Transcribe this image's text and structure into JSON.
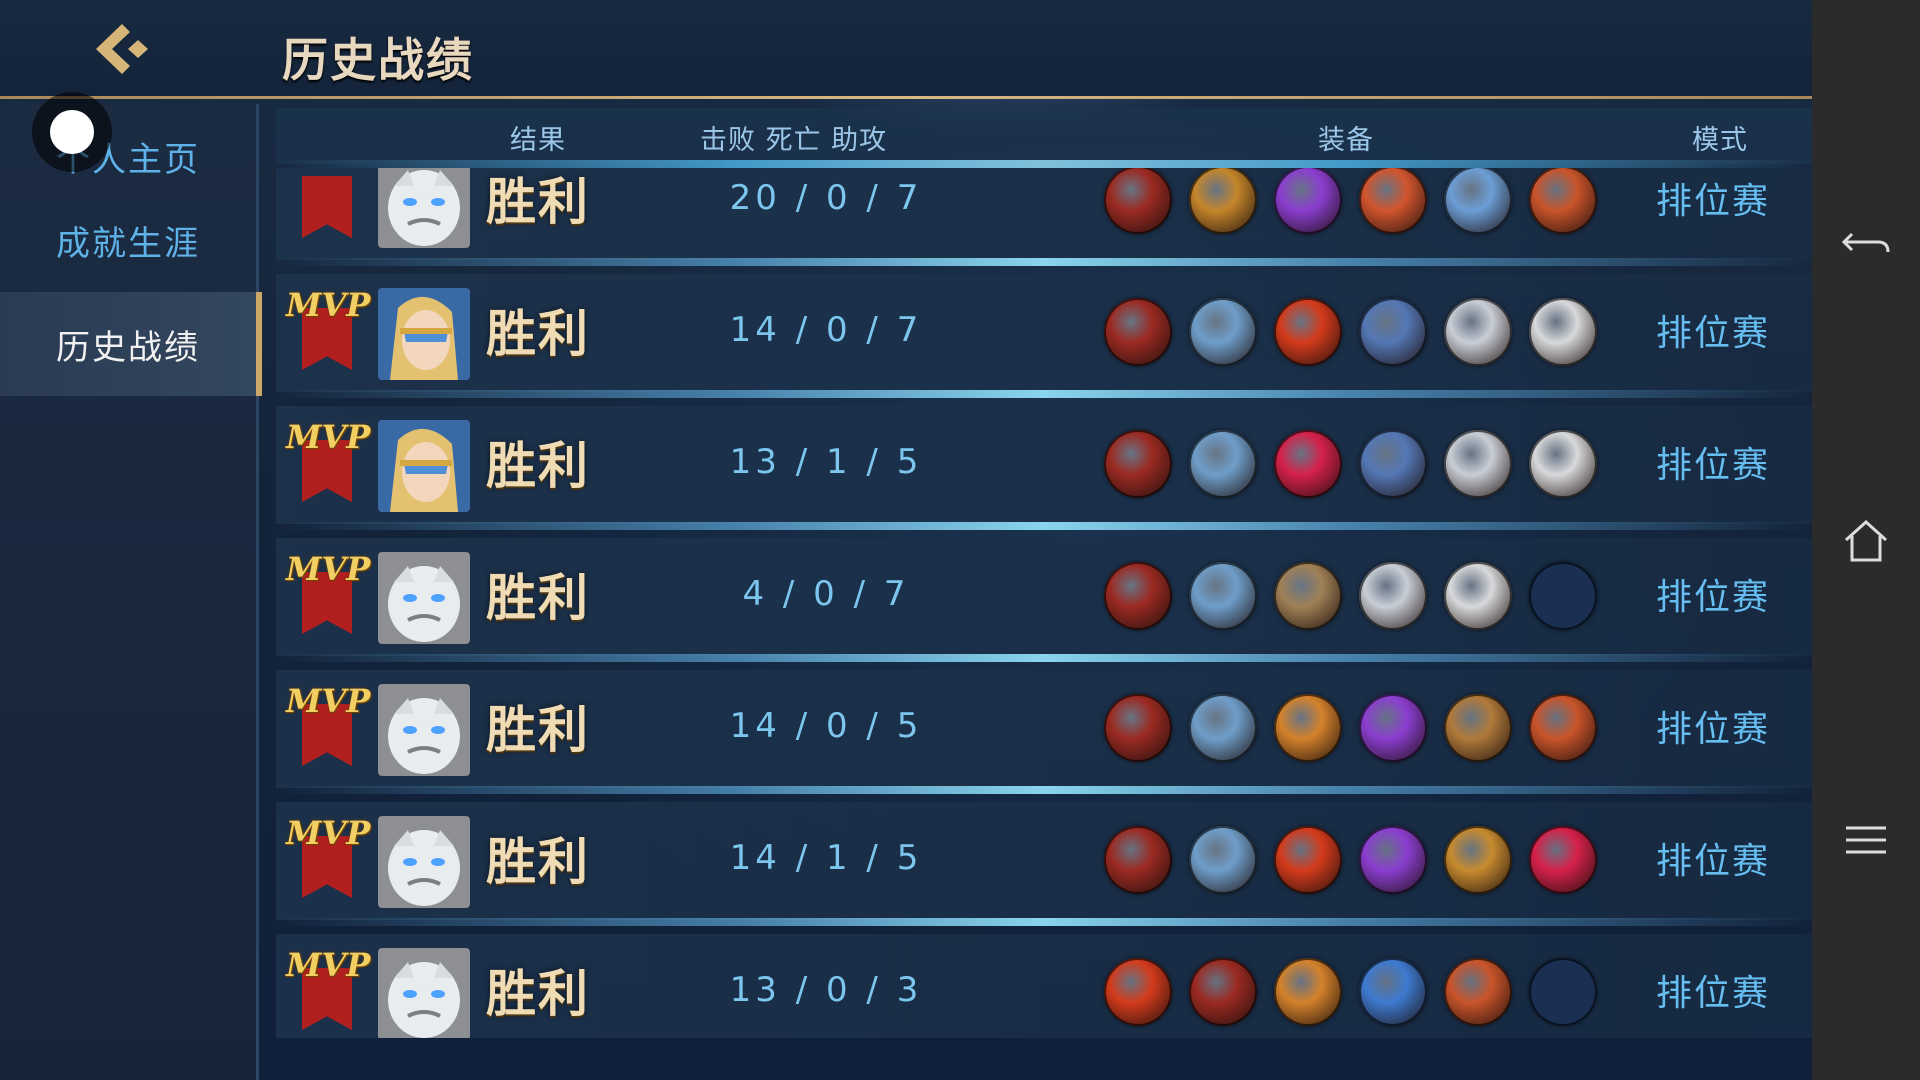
{
  "header": {
    "title": "历史战绩"
  },
  "sidebar": {
    "items": [
      {
        "label": "个人主页"
      },
      {
        "label": "成就生涯"
      },
      {
        "label": "历史战绩"
      }
    ]
  },
  "columns": {
    "result": "结果",
    "kda": "击败 死亡 助攻",
    "equipment": "装备",
    "mode": "模式"
  },
  "matches": [
    {
      "mvp": false,
      "result": "胜利",
      "kda": "20 / 0 / 7",
      "mode": "排位赛",
      "hero_icon": "white-beast-hero-icon",
      "items": [
        "#9b2a22",
        "#c5862b",
        "#8b3ed0",
        "#d2552e",
        "#6c9ed6",
        "#c9542a"
      ]
    },
    {
      "mvp": true,
      "mvp_label": "MVP",
      "result": "胜利",
      "kda": "14 / 0 / 7",
      "mode": "排位赛",
      "hero_icon": "masked-blonde-hero-icon",
      "items": [
        "#9b2a22",
        "#6f9ec9",
        "#d43b1c",
        "#5477b5",
        "#c9ced6",
        "#d8d9db"
      ]
    },
    {
      "mvp": true,
      "mvp_label": "MVP",
      "result": "胜利",
      "kda": "13 / 1 / 5",
      "mode": "排位赛",
      "hero_icon": "masked-blonde-hero-icon",
      "items": [
        "#9b2a22",
        "#6f9ec9",
        "#d6214a",
        "#5477b5",
        "#c9ced6",
        "#d8d9db"
      ]
    },
    {
      "mvp": true,
      "mvp_label": "MVP",
      "result": "胜利",
      "kda": "4 / 0 / 7",
      "mode": "排位赛",
      "hero_icon": "white-beast-hero-icon",
      "items": [
        "#9b2a22",
        "#6f9ec9",
        "#a08156",
        "#c9ced6",
        "#d8d9db",
        "empty"
      ]
    },
    {
      "mvp": true,
      "mvp_label": "MVP",
      "result": "胜利",
      "kda": "14 / 0 / 5",
      "mode": "排位赛",
      "hero_icon": "white-beast-hero-icon",
      "items": [
        "#9b2a22",
        "#6f9ec9",
        "#d4822b",
        "#8b3ed0",
        "#b07a3a",
        "#c9542a"
      ]
    },
    {
      "mvp": true,
      "mvp_label": "MVP",
      "result": "胜利",
      "kda": "14 / 1 / 5",
      "mode": "排位赛",
      "hero_icon": "white-beast-hero-icon",
      "items": [
        "#9b2a22",
        "#6f9ec9",
        "#d43b1c",
        "#8b3ed0",
        "#c78b2f",
        "#d6214a"
      ]
    },
    {
      "mvp": true,
      "mvp_label": "MVP",
      "result": "胜利",
      "kda": "13 / 0 / 3",
      "mode": "排位赛",
      "hero_icon": "white-beast-hero-icon",
      "items": [
        "#d43b1c",
        "#9b2a22",
        "#d4822b",
        "#3d7ad0",
        "#c9542a",
        "empty"
      ]
    }
  ],
  "colors": {
    "accent_gold": "#c9a868",
    "link_blue": "#66bdf0",
    "mvp_ribbon": "#b21f1f"
  }
}
